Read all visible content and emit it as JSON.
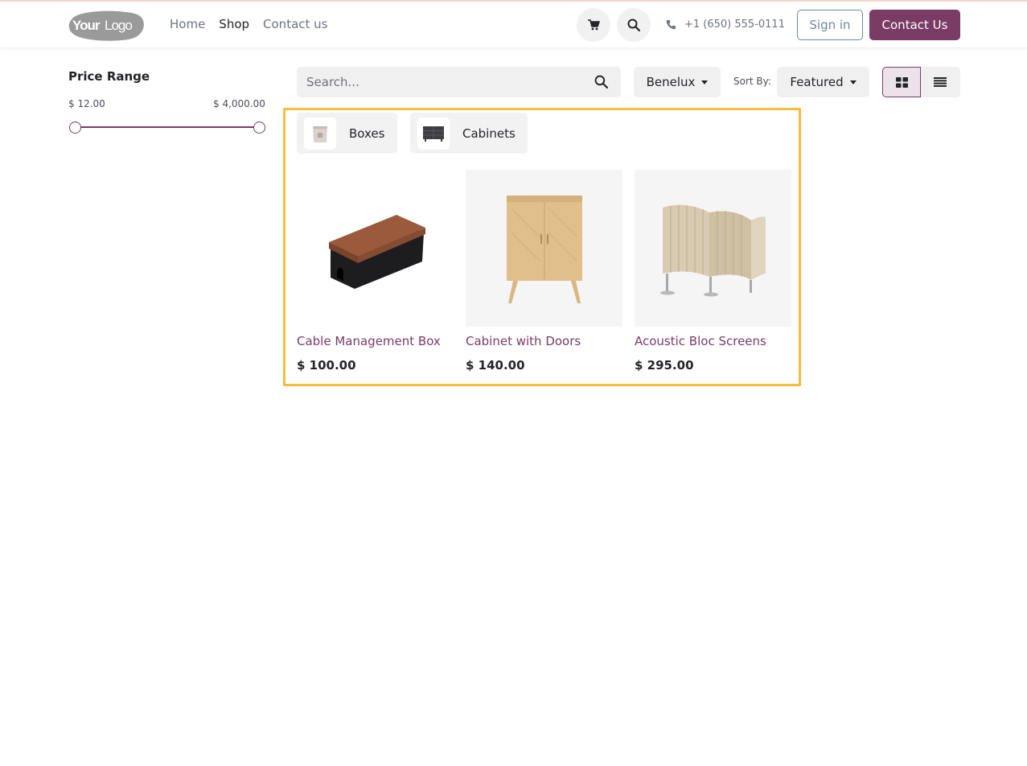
{
  "header": {
    "logo_text": "YourLogo",
    "nav": [
      "Home",
      "Shop",
      "Contact us"
    ],
    "active_nav": "Shop",
    "phone": "+1 (650) 555-0111",
    "sign_in_label": "Sign in",
    "contact_label": "Contact Us",
    "cart_icon": "cart-icon",
    "search_icon": "search-icon"
  },
  "sidebar": {
    "title": "Price Range",
    "min_price": "$ 12.00",
    "max_price": "$ 4,000.00"
  },
  "toolbar": {
    "search_placeholder": "Search...",
    "pricelist_label": "Benelux",
    "sort_by_label": "Sort By:",
    "sort_value": "Featured"
  },
  "categories": [
    {
      "label": "Boxes"
    },
    {
      "label": "Cabinets"
    }
  ],
  "products": [
    {
      "name": "Cable Management Box",
      "price": "$ 100.00"
    },
    {
      "name": "Cabinet with Doors",
      "price": "$ 140.00"
    },
    {
      "name": "Acoustic Bloc Screens",
      "price": "$ 295.00"
    }
  ],
  "colors": {
    "brand": "#7a3b65",
    "highlight": "#f9bd3d"
  }
}
